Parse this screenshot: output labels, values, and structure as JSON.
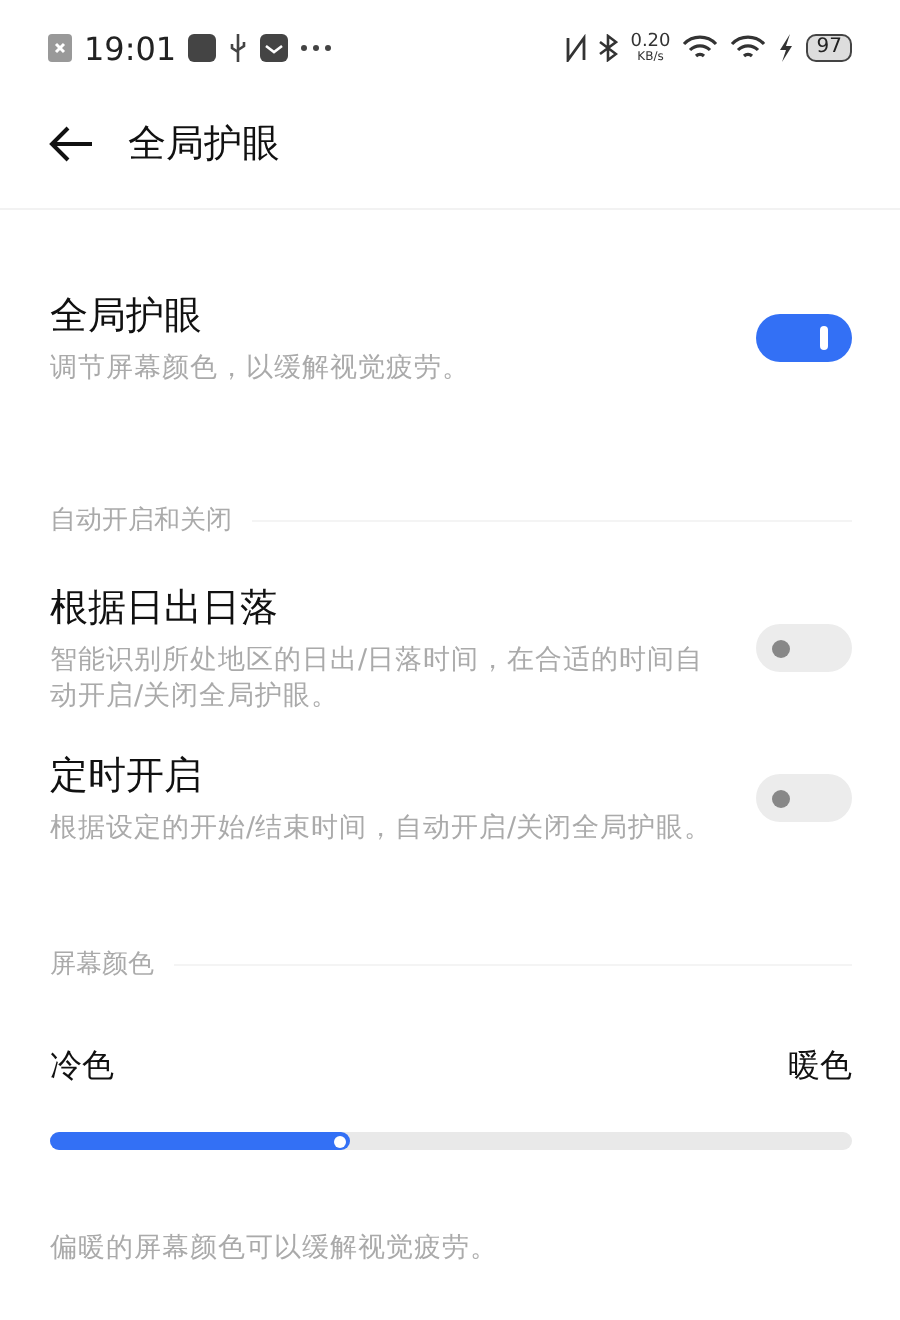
{
  "status_bar": {
    "time": "19:01",
    "speed_value": "0.20",
    "speed_unit": "KB/s",
    "battery": "97"
  },
  "header": {
    "title": "全局护眼"
  },
  "main_setting": {
    "title": "全局护眼",
    "description": "调节屏幕颜色，以缓解视觉疲劳。",
    "on": true
  },
  "auto_section": {
    "title": "自动开启和关闭",
    "items": [
      {
        "title": "根据日出日落",
        "description": "智能识别所处地区的日出/日落时间，在合适的时间自动开启/关闭全局护眼。",
        "on": false
      },
      {
        "title": "定时开启",
        "description": "根据设定的开始/结束时间，自动开启/关闭全局护眼。",
        "on": false
      }
    ]
  },
  "color_section": {
    "title": "屏幕颜色",
    "min_label": "冷色",
    "max_label": "暖色",
    "level": 0.375,
    "note": "偏暖的屏幕颜色可以缓解视觉疲劳。"
  }
}
